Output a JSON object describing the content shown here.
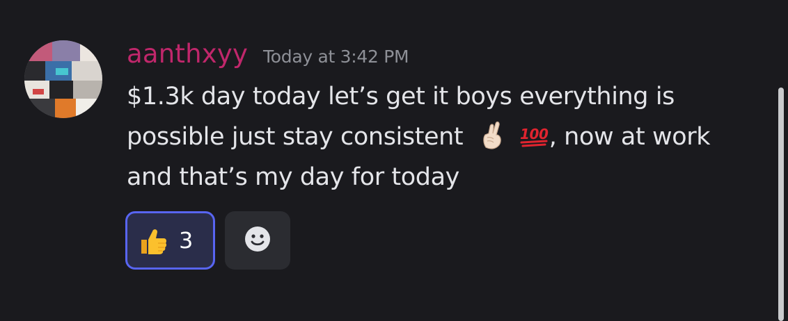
{
  "message": {
    "author": "aanthxyy",
    "timestamp": "Today at 3:42 PM",
    "content_lines": [
      "$1.3k day today let’s get it boys everything is",
      "possible just stay consistent",
      ", now at work",
      "and that’s my day for today"
    ],
    "inline_emojis": [
      "crossed-fingers-emoji",
      "hundred-points-emoji"
    ]
  },
  "reactions": [
    {
      "emoji": "thumbs-up-emoji",
      "count": "3",
      "selected": true
    }
  ],
  "add_reaction": {
    "icon": "smiley-face-icon"
  },
  "colors": {
    "background": "#1a1a1e",
    "username": "#c0276b",
    "timestamp": "#8e9097",
    "text": "#e4e5e9",
    "reaction_active_bg": "#2a2d4a",
    "reaction_active_border": "#5865f2",
    "add_reaction_bg": "#2b2c31"
  }
}
